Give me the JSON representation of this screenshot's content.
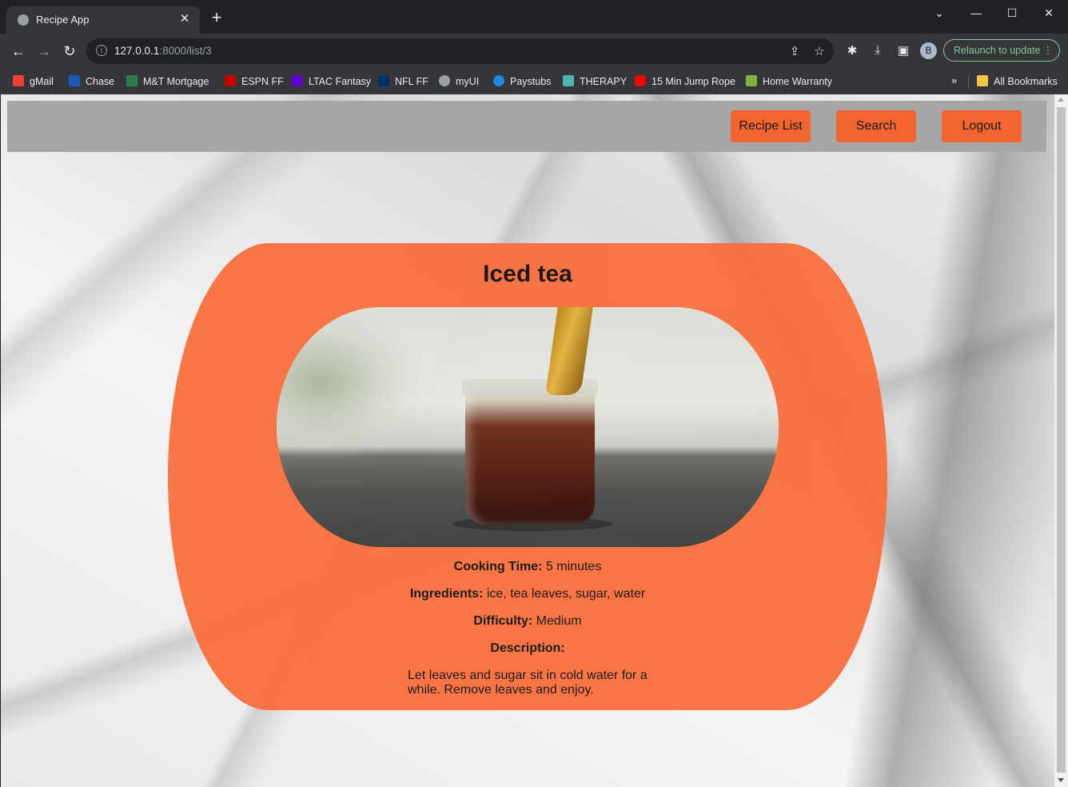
{
  "browser": {
    "tab_title": "Recipe App",
    "url_host": "127.0.0.1",
    "url_rest": ":8000/list/3",
    "profile_initial": "B",
    "relaunch_label": "Relaunch to update",
    "bookmarks": [
      {
        "label": "gMail",
        "color": "#ea4335"
      },
      {
        "label": "Chase",
        "color": "#1a5ab8"
      },
      {
        "label": "M&T Mortgage",
        "color": "#2e7d4f"
      },
      {
        "label": "ESPN FF",
        "color": "#cc0000"
      },
      {
        "label": "LTAC Fantasy",
        "color": "#6001d2"
      },
      {
        "label": "NFL FF",
        "color": "#013369"
      },
      {
        "label": "myUI",
        "color": "#9aa0a6"
      },
      {
        "label": "Paystubs",
        "color": "#1e88e5"
      },
      {
        "label": "THERAPY",
        "color": "#4db6ac"
      },
      {
        "label": "15 Min Jump Rope",
        "color": "#ff0000"
      },
      {
        "label": "Home Warranty",
        "color": "#7cb342"
      }
    ],
    "all_bookmarks_label": "All Bookmarks"
  },
  "nav": {
    "recipe_list": "Recipe List",
    "search": "Search",
    "logout": "Logout"
  },
  "recipe": {
    "title": "Iced tea",
    "cooking_time_label": "Cooking Time:",
    "cooking_time": "5 minutes",
    "ingredients_label": "Ingredients:",
    "ingredients": "ice, tea leaves, sugar, water",
    "difficulty_label": "Difficulty:",
    "difficulty": "Medium",
    "description_label": "Description:",
    "description": "Let leaves and sugar sit in cold water for a while. Remove leaves and enjoy."
  },
  "colors": {
    "accent": "#f26430",
    "card": "#fa6f3d",
    "navbar": "#a6a6a6"
  }
}
